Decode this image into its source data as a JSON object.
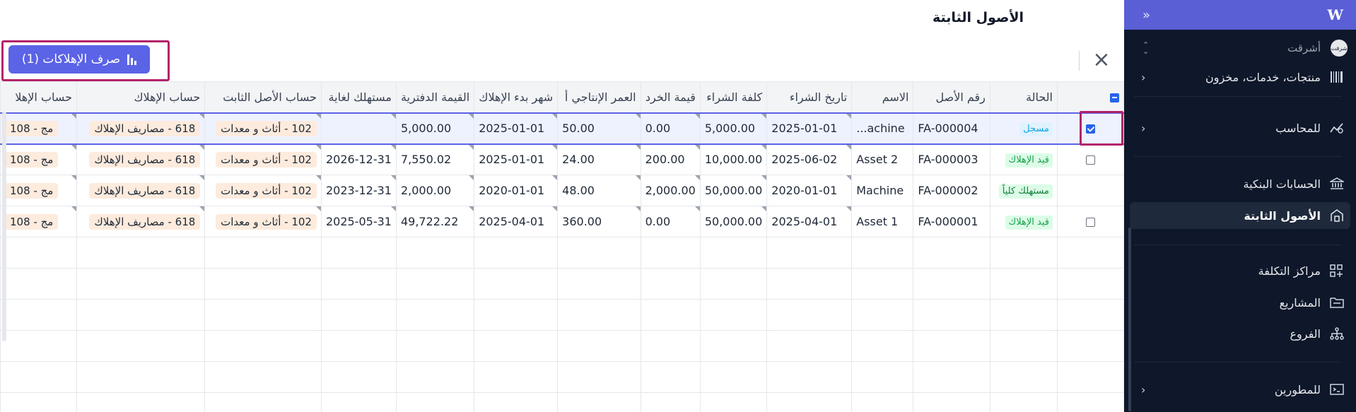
{
  "sidebar": {
    "logo": "W",
    "collapse_icon": "«",
    "company": {
      "name": "أشرقت",
      "avatar": "شرقت"
    },
    "items": [
      {
        "label": "منتجات، خدمات، مخزون",
        "icon": "barcode-icon",
        "chevron": true,
        "active": false
      },
      {
        "label": "للمحاسب",
        "icon": "chart-line-icon",
        "chevron": true,
        "active": false
      },
      {
        "label": "الحسابات البنكية",
        "icon": "bank-icon",
        "chevron": false,
        "active": false
      },
      {
        "label": "الأصول الثابتة",
        "icon": "building-icon",
        "chevron": false,
        "active": true
      },
      {
        "label": "مراكز التكلفة",
        "icon": "grid-plus-icon",
        "chevron": false,
        "active": false
      },
      {
        "label": "المشاريع",
        "icon": "folder-icon",
        "chevron": false,
        "active": false
      },
      {
        "label": "الفروع",
        "icon": "branches-icon",
        "chevron": false,
        "active": false
      },
      {
        "label": "للمطورين",
        "icon": "terminal-icon",
        "chevron": true,
        "active": false
      }
    ]
  },
  "main": {
    "title": "الأصول الثابتة",
    "depreciation_button": "صرف الإهلاكات (1)",
    "close_icon": "close-icon"
  },
  "table": {
    "columns": [
      "الحالة",
      "رقم الأصل",
      "الاسم",
      "تاريخ الشراء",
      "كلفة الشراء",
      "قيمة الخرد",
      "العمر الإنتاجي أ",
      "شهر بدء الإهلاك",
      "القيمة الدفترية",
      "مستهلك لغاية",
      "حساب الأصل الثابت",
      "حساب الإهلاك",
      "حساب الإهلا"
    ],
    "rows": [
      {
        "checked": true,
        "has_checkbox": true,
        "status": "مسجل",
        "status_color": "#0ea5e9",
        "status_bg": "#e0f2fe",
        "asset_no": "FA-000004",
        "name": "...achine",
        "purchase_date": "2025-01-01",
        "cost": "5,000.00",
        "salvage": "0.00",
        "life": "50.00",
        "dep_start": "2025-01-01",
        "book_value": "5,000.00",
        "depreciated_until": "",
        "asset_account": "102 - أثاث و معدات",
        "dep_account": "618 - مصاريف الإهلاك",
        "acc_dep_account": "108 - مج"
      },
      {
        "checked": false,
        "has_checkbox": true,
        "status": "قيد الإهلاك",
        "status_color": "#16a34a",
        "status_bg": "#dcfce7",
        "asset_no": "FA-000003",
        "name": "Asset 2",
        "purchase_date": "2025-06-02",
        "cost": "10,000.00",
        "salvage": "200.00",
        "life": "24.00",
        "dep_start": "2025-01-01",
        "book_value": "7,550.02",
        "depreciated_until": "2026-12-31",
        "asset_account": "102 - أثاث و معدات",
        "dep_account": "618 - مصاريف الإهلاك",
        "acc_dep_account": "108 - مج"
      },
      {
        "checked": false,
        "has_checkbox": false,
        "status": "مستهلك كلياً",
        "status_color": "#15803d",
        "status_bg": "#dcfce7",
        "asset_no": "FA-000002",
        "name": "Machine",
        "purchase_date": "2020-01-01",
        "cost": "50,000.00",
        "salvage": "2,000.00",
        "life": "48.00",
        "dep_start": "2020-01-01",
        "book_value": "2,000.00",
        "depreciated_until": "2023-12-31",
        "asset_account": "102 - أثاث و معدات",
        "dep_account": "618 - مصاريف الإهلاك",
        "acc_dep_account": "108 - مج"
      },
      {
        "checked": false,
        "has_checkbox": true,
        "status": "قيد الإهلاك",
        "status_color": "#16a34a",
        "status_bg": "#dcfce7",
        "asset_no": "FA-000001",
        "name": "Asset 1",
        "purchase_date": "2025-04-01",
        "cost": "50,000.00",
        "salvage": "0.00",
        "life": "360.00",
        "dep_start": "2025-04-01",
        "book_value": "49,722.22",
        "depreciated_until": "2025-05-31",
        "asset_account": "102 - أثاث و معدات",
        "dep_account": "618 - مصاريف الإهلاك",
        "acc_dep_account": "108 - مج"
      }
    ],
    "empty_rows": 6
  },
  "colors": {
    "accent": "#5b63e6",
    "sidebar_bg": "#0f172a",
    "highlight_frame": "#b4236b"
  }
}
